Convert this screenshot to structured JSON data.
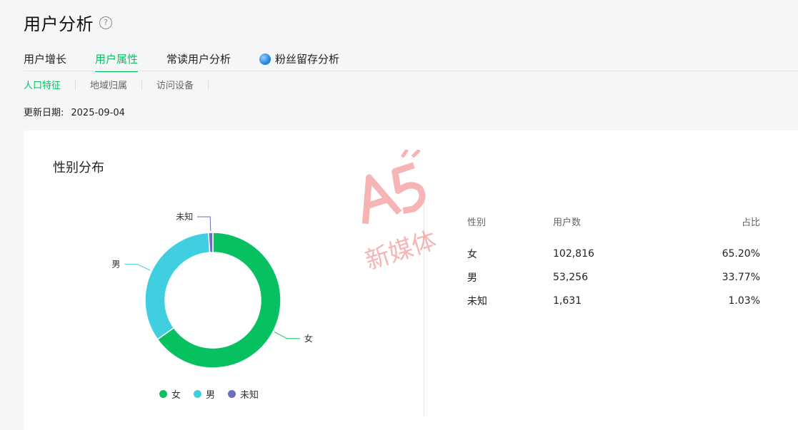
{
  "header": {
    "title": "用户分析",
    "help_icon": "question-circle-icon"
  },
  "tabs": [
    {
      "label": "用户增长",
      "active": false
    },
    {
      "label": "用户属性",
      "active": true
    },
    {
      "label": "常读用户分析",
      "active": false
    },
    {
      "label": "粉丝留存分析",
      "active": false,
      "icon": "blue-badge-icon"
    }
  ],
  "subtabs": [
    {
      "label": "人口特征",
      "active": true
    },
    {
      "label": "地域归属",
      "active": false
    },
    {
      "label": "访问设备",
      "active": false
    }
  ],
  "update": {
    "label": "更新日期:",
    "date": "2025-09-04"
  },
  "card": {
    "title": "性别分布"
  },
  "table": {
    "headers": [
      "性别",
      "用户数",
      "占比"
    ],
    "rows": [
      [
        "女",
        "102,816",
        "65.20%"
      ],
      [
        "男",
        "53,256",
        "33.77%"
      ],
      [
        "未知",
        "1,631",
        "1.03%"
      ]
    ]
  },
  "chart_data": {
    "type": "pie",
    "title": "性别分布",
    "categories": [
      "女",
      "男",
      "未知"
    ],
    "values": [
      65.2,
      33.77,
      1.03
    ],
    "colors": [
      "#07c160",
      "#40cfe0",
      "#6b6fc0"
    ],
    "legend": "bottom",
    "slice_labels": [
      "女",
      "男",
      "未知"
    ]
  },
  "watermark": {
    "text": "A5 新媒体",
    "color": "#f07878"
  }
}
